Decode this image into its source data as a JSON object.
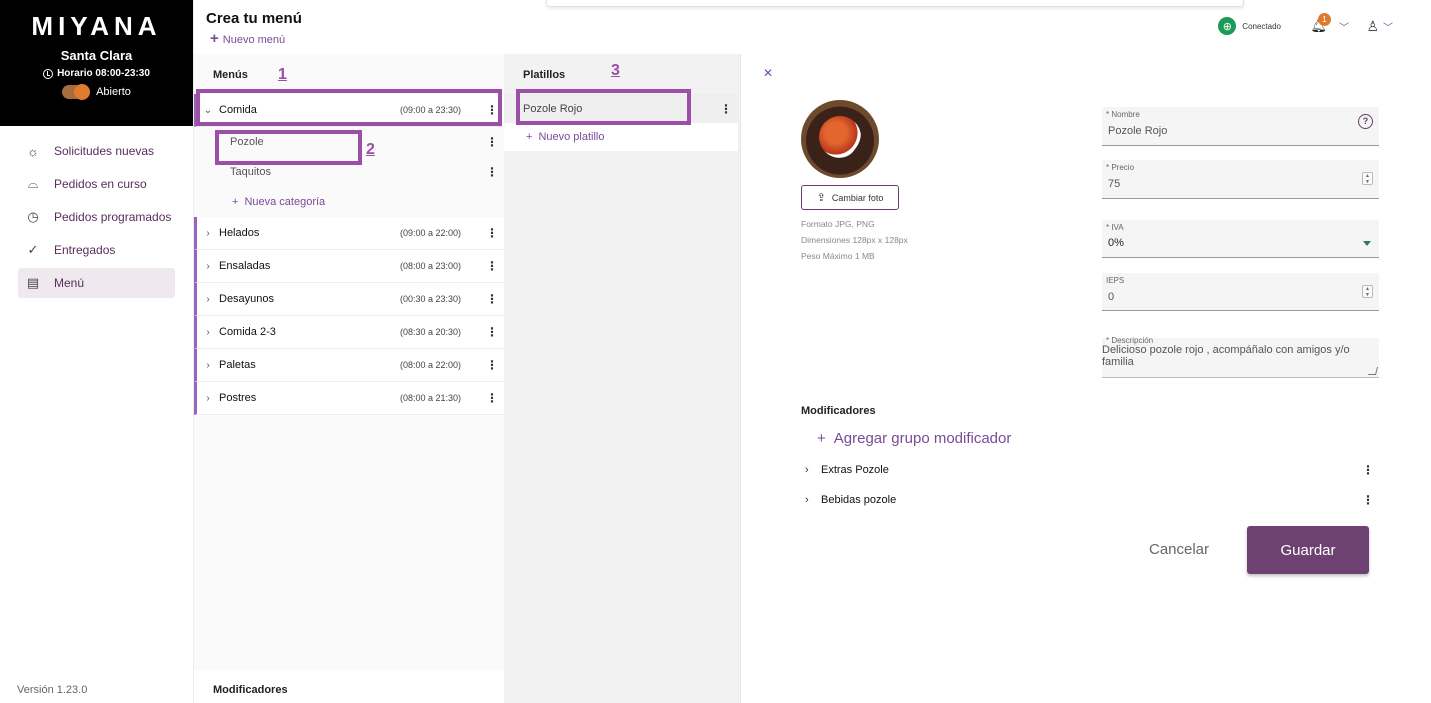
{
  "brand": {
    "logo": "MIYANA",
    "store": "Santa Clara",
    "hours": "Horario 08:00-23:30",
    "status": "Abierto"
  },
  "nav": [
    {
      "label": "Solicitudes nuevas",
      "icon": "sun-rise-icon"
    },
    {
      "label": "Pedidos en curso",
      "icon": "delivery-icon"
    },
    {
      "label": "Pedidos programados",
      "icon": "clock-icon"
    },
    {
      "label": "Entregados",
      "icon": "check-circle-icon"
    },
    {
      "label": "Menú",
      "icon": "menu-book-icon",
      "active": true
    }
  ],
  "version": "Versión 1.23.0",
  "header": {
    "title": "Crea tu menú",
    "new_menu": "Nuevo menú",
    "connected": "Conectado",
    "notifications": "1"
  },
  "menus": {
    "title": "Menús",
    "items": [
      {
        "name": "Comida",
        "time": "(09:00 a 23:30)",
        "open": true
      },
      {
        "name": "Helados",
        "time": "(09:00 a 22:00)"
      },
      {
        "name": "Ensaladas",
        "time": "(08:00 a 23:00)"
      },
      {
        "name": "Desayunos",
        "time": "(00:30 a 23:30)"
      },
      {
        "name": "Comida 2-3",
        "time": "(08:30 a 20:30)"
      },
      {
        "name": "Paletas",
        "time": "(08:00 a 22:00)"
      },
      {
        "name": "Postres",
        "time": "(08:00 a 21:30)"
      }
    ],
    "categories": [
      "Pozole",
      "Taquitos"
    ],
    "new_category": "Nueva categoría",
    "modifiers_title": "Modificadores"
  },
  "platillos": {
    "title": "Platillos",
    "items": [
      "Pozole Rojo"
    ],
    "new_item": "Nuevo platillo"
  },
  "detail": {
    "change_photo": "Cambiar foto",
    "photo_info": [
      "Formato JPG, PNG",
      "Dimensiones 128px x 128px",
      "Peso Máximo 1 MB"
    ],
    "fields": {
      "name_label": "* Nombre",
      "name_value": "Pozole Rojo",
      "price_label": "* Precio",
      "price_value": "75",
      "iva_label": "* IVA",
      "iva_value": "0%",
      "ieps_label": "IEPS",
      "ieps_value": "0",
      "desc_label": "* Descripción",
      "desc_value": "Delicioso pozole rojo , acompáñalo con amigos y/o familia"
    },
    "modifiers_title": "Modificadores",
    "add_group": "Agregar grupo modificador",
    "groups": [
      "Extras Pozole",
      "Bebidas pozole"
    ],
    "cancel": "Cancelar",
    "save": "Guardar"
  },
  "annotations": [
    "1",
    "2",
    "3"
  ],
  "colors": {
    "accent": "#7a4a9a",
    "primary_button": "#6e4270",
    "annotation": "#9b4fa6",
    "connected": "#1b9a58",
    "badge": "#e07a2e"
  }
}
